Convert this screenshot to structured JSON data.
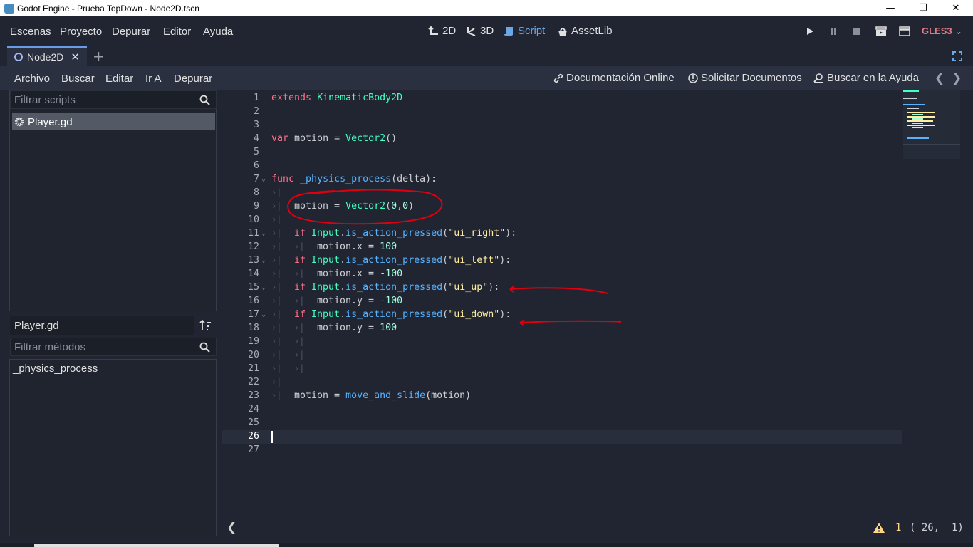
{
  "window": {
    "title": "Godot Engine - Prueba TopDown - Node2D.tscn",
    "minimize_glyph": "—",
    "maximize_glyph": "❐",
    "close_glyph": "✕"
  },
  "menubar": {
    "menus": [
      "Escenas",
      "Proyecto",
      "Depurar",
      "Editor",
      "Ayuda"
    ],
    "workspaces": [
      {
        "label": "2D",
        "icon": "2d-icon",
        "active": false
      },
      {
        "label": "3D",
        "icon": "3d-icon",
        "active": false
      },
      {
        "label": "Script",
        "icon": "script-icon",
        "active": true
      },
      {
        "label": "AssetLib",
        "icon": "assetlib-icon",
        "active": false
      }
    ],
    "renderer": "GLES3",
    "accent_color": "#6ba7e6",
    "renderer_color": "#e27a87"
  },
  "scene_tabs": {
    "tabs": [
      {
        "label": "Node2D"
      }
    ],
    "close_glyph": "✕",
    "add_glyph": "+"
  },
  "script_toolbar": {
    "menus": [
      "Archivo",
      "Buscar",
      "Editar",
      "Ir A",
      "Depurar"
    ],
    "online_docs": "Documentación Online",
    "request_docs": "Solicitar Documentos",
    "search_help": "Buscar en la Ayuda",
    "prev_glyph": "❮",
    "next_glyph": "❯"
  },
  "scripts_panel": {
    "filter_placeholder": "Filtrar scripts",
    "items": [
      {
        "label": "Player.gd",
        "selected": true
      }
    ]
  },
  "methods_panel": {
    "current_script": "Player.gd",
    "filter_placeholder": "Filtrar métodos",
    "methods": [
      "_physics_process"
    ]
  },
  "editor": {
    "lines": [
      {
        "n": "1",
        "tokens": [
          [
            "kw",
            "extends"
          ],
          [
            "pl",
            " "
          ],
          [
            "ty",
            "KinematicBody2D"
          ]
        ]
      },
      {
        "n": "2",
        "tokens": []
      },
      {
        "n": "3",
        "tokens": []
      },
      {
        "n": "4",
        "tokens": [
          [
            "kw",
            "var"
          ],
          [
            "pl",
            " motion = "
          ],
          [
            "ty",
            "Vector2"
          ],
          [
            "pl",
            "()"
          ]
        ]
      },
      {
        "n": "5",
        "tokens": []
      },
      {
        "n": "6",
        "tokens": []
      },
      {
        "n": "7",
        "fold": true,
        "tokens": [
          [
            "kw",
            "func"
          ],
          [
            "pl",
            " "
          ],
          [
            "fn",
            "_physics_process"
          ],
          [
            "pl",
            "(delta):"
          ]
        ]
      },
      {
        "n": "8",
        "tabs": 1,
        "tokens": []
      },
      {
        "n": "9",
        "tabs": 1,
        "tokens": [
          [
            "pl",
            "motion = "
          ],
          [
            "ty",
            "Vector2"
          ],
          [
            "pl",
            "("
          ],
          [
            "nu",
            "0"
          ],
          [
            "pl",
            ","
          ],
          [
            "nu",
            "0"
          ],
          [
            "pl",
            ")"
          ]
        ]
      },
      {
        "n": "10",
        "tabs": 1,
        "tokens": []
      },
      {
        "n": "11",
        "fold": true,
        "tabs": 1,
        "tokens": [
          [
            "kw",
            "if"
          ],
          [
            "pl",
            " "
          ],
          [
            "ty",
            "Input"
          ],
          [
            "pl",
            "."
          ],
          [
            "fn",
            "is_action_pressed"
          ],
          [
            "pl",
            "("
          ],
          [
            "st",
            "\"ui_right\""
          ],
          [
            "pl",
            "):"
          ]
        ]
      },
      {
        "n": "12",
        "tabs": 2,
        "tokens": [
          [
            "pl",
            "motion.x = "
          ],
          [
            "nu",
            "100"
          ]
        ]
      },
      {
        "n": "13",
        "fold": true,
        "tabs": 1,
        "tokens": [
          [
            "kw",
            "if"
          ],
          [
            "pl",
            " "
          ],
          [
            "ty",
            "Input"
          ],
          [
            "pl",
            "."
          ],
          [
            "fn",
            "is_action_pressed"
          ],
          [
            "pl",
            "("
          ],
          [
            "st",
            "\"ui_left\""
          ],
          [
            "pl",
            "):"
          ]
        ]
      },
      {
        "n": "14",
        "tabs": 2,
        "tokens": [
          [
            "pl",
            "motion.x = "
          ],
          [
            "nu",
            "-100"
          ]
        ]
      },
      {
        "n": "15",
        "fold": true,
        "tabs": 1,
        "tokens": [
          [
            "kw",
            "if"
          ],
          [
            "pl",
            " "
          ],
          [
            "ty",
            "Input"
          ],
          [
            "pl",
            "."
          ],
          [
            "fn",
            "is_action_pressed"
          ],
          [
            "pl",
            "("
          ],
          [
            "st",
            "\"ui_up\""
          ],
          [
            "pl",
            "):"
          ]
        ]
      },
      {
        "n": "16",
        "tabs": 2,
        "tokens": [
          [
            "pl",
            "motion.y = "
          ],
          [
            "nu",
            "-100"
          ]
        ]
      },
      {
        "n": "17",
        "fold": true,
        "tabs": 1,
        "tokens": [
          [
            "kw",
            "if"
          ],
          [
            "pl",
            " "
          ],
          [
            "ty",
            "Input"
          ],
          [
            "pl",
            "."
          ],
          [
            "fn",
            "is_action_pressed"
          ],
          [
            "pl",
            "("
          ],
          [
            "st",
            "\"ui_down\""
          ],
          [
            "pl",
            "):"
          ]
        ]
      },
      {
        "n": "18",
        "tabs": 2,
        "tokens": [
          [
            "pl",
            "motion.y = "
          ],
          [
            "nu",
            "100"
          ]
        ]
      },
      {
        "n": "19",
        "tabs": 2,
        "tokens": []
      },
      {
        "n": "20",
        "tabs": 2,
        "tokens": []
      },
      {
        "n": "21",
        "tabs": 2,
        "tokens": []
      },
      {
        "n": "22",
        "tabs": 1,
        "tokens": []
      },
      {
        "n": "23",
        "tabs": 1,
        "tokens": [
          [
            "pl",
            "motion = "
          ],
          [
            "fn",
            "move_and_slide"
          ],
          [
            "pl",
            "(motion)"
          ]
        ]
      },
      {
        "n": "24",
        "tokens": []
      },
      {
        "n": "25",
        "tokens": []
      },
      {
        "n": "26",
        "current": true,
        "tokens": []
      },
      {
        "n": "27",
        "tokens": []
      }
    ],
    "tab_glyph": "›|",
    "fold_glyph": "⌄"
  },
  "statusbar": {
    "collapse_glyph": "❮",
    "warning_count": "1",
    "cursor_pos": "( 26,  1)",
    "warning_color": "#ffd684"
  },
  "annotation_color": "#e0000f"
}
